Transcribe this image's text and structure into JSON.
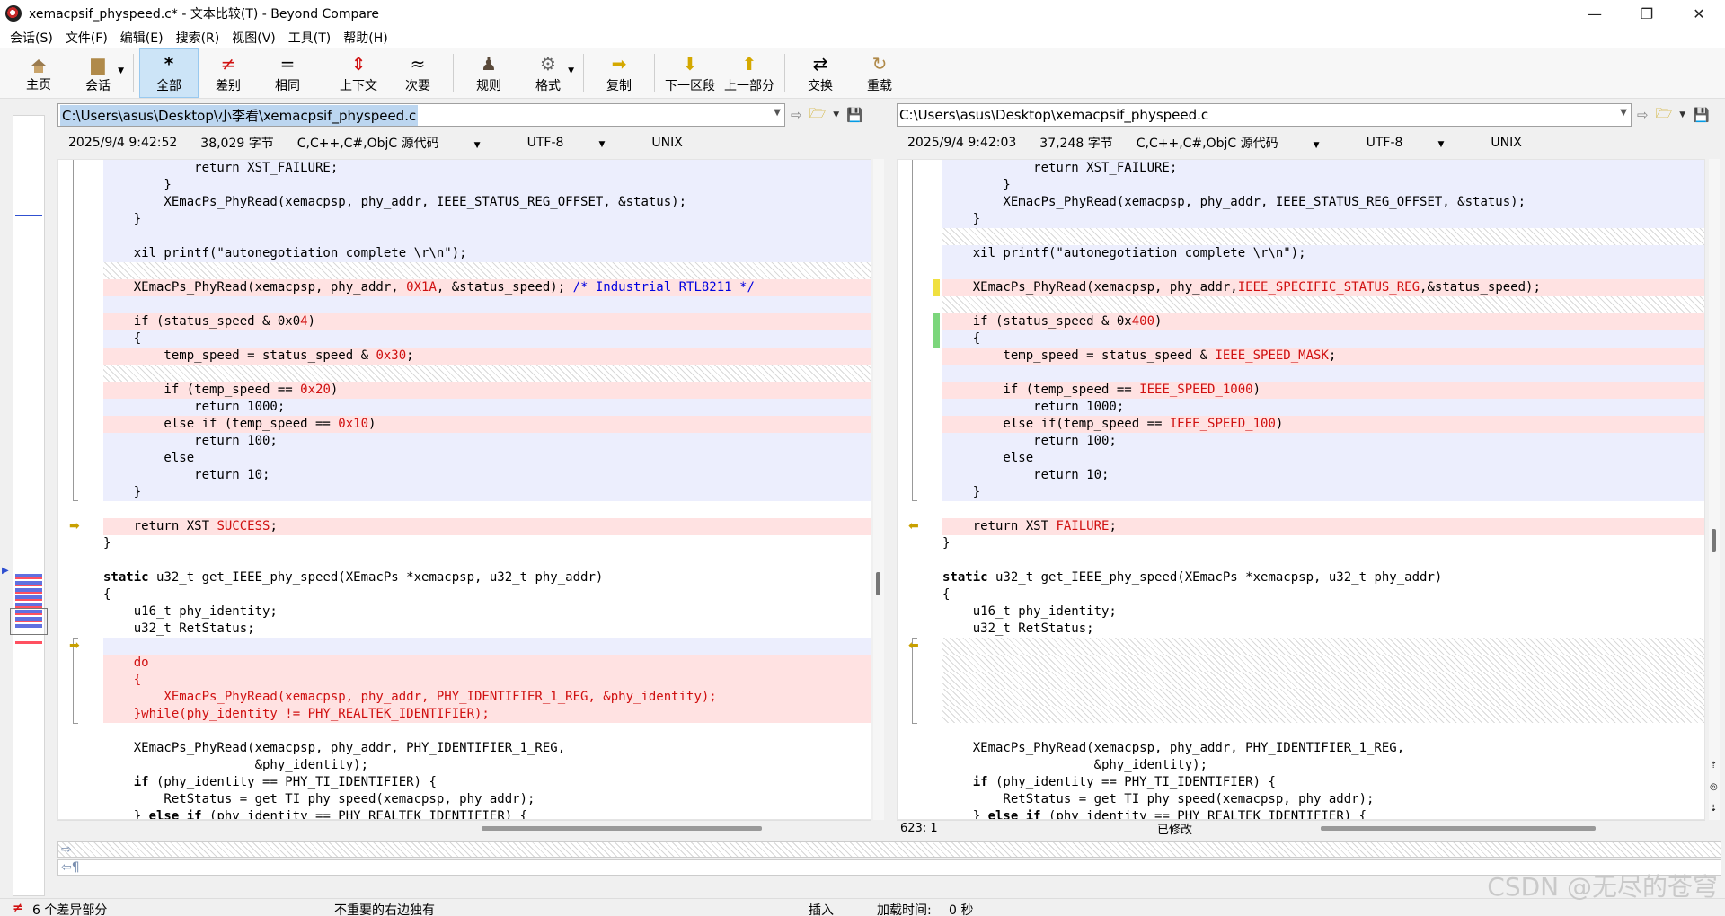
{
  "window": {
    "title": "xemacpsif_physpeed.c* - 文本比较(T) - Beyond Compare",
    "controls": {
      "minimize": "—",
      "maximize": "❐",
      "close": "✕"
    }
  },
  "menu": [
    "会话(S)",
    "文件(F)",
    "编辑(E)",
    "搜索(R)",
    "视图(V)",
    "工具(T)",
    "帮助(H)"
  ],
  "toolbar": {
    "home": "主页",
    "session": "会话",
    "all": "全部",
    "diffs": "差别",
    "same": "相同",
    "context": "上下文",
    "minor": "次要",
    "rules": "规则",
    "format": "格式",
    "copy": "复制",
    "next_section": "下一区段",
    "prev_section": "上一部分",
    "swap": "交换",
    "reload": "重载"
  },
  "left": {
    "path_prefix": "C:\\Users\\asus\\Desktop\\",
    "path_rest": "小李看\\xemacpsif_physpeed.c",
    "date": "2025/9/4 9:42:52",
    "size": "38,029 字节",
    "lang": "C,C++,C#,ObjC 源代码",
    "encoding": "UTF-8",
    "eol": "UNIX"
  },
  "right": {
    "path": "C:\\Users\\asus\\Desktop\\xemacpsif_physpeed.c",
    "date": "2025/9/4 9:42:03",
    "size": "37,248 字节",
    "lang": "C,C++,C#,ObjC 源代码",
    "encoding": "UTF-8",
    "eol": "UNIX"
  },
  "left_code": [
    {
      "cls": "ln-blue",
      "segs": [
        [
          "",
          "            return XST_FAILURE;"
        ]
      ]
    },
    {
      "cls": "ln-blue",
      "segs": [
        [
          "",
          "        }"
        ]
      ]
    },
    {
      "cls": "ln-blue",
      "segs": [
        [
          "",
          "        XEmacPs_PhyRead(xemacpsp, phy_addr, IEEE_STATUS_REG_OFFSET, &status);"
        ]
      ]
    },
    {
      "cls": "ln-blue",
      "segs": [
        [
          "",
          "    }"
        ]
      ]
    },
    {
      "cls": "ln-blue",
      "segs": [
        [
          "",
          ""
        ]
      ]
    },
    {
      "cls": "ln-blue",
      "segs": [
        [
          "",
          "    xil_printf(\"autonegotiation complete \\r\\n\");"
        ]
      ]
    },
    {
      "cls": "ln-hatch",
      "segs": [
        [
          "",
          ""
        ]
      ]
    },
    {
      "cls": "ln-red",
      "segs": [
        [
          "",
          "    XEmacPs_PhyRead(xemacpsp, phy_addr, "
        ],
        [
          "d",
          "0X1A"
        ],
        [
          "",
          ", &status_speed); "
        ],
        [
          "cm",
          "/* Industrial RTL8211 */"
        ]
      ]
    },
    {
      "cls": "ln-blue",
      "segs": [
        [
          "",
          ""
        ]
      ]
    },
    {
      "cls": "ln-red",
      "segs": [
        [
          "",
          "    if (status_speed & 0x0"
        ],
        [
          "d",
          "4"
        ],
        [
          "",
          ")"
        ]
      ]
    },
    {
      "cls": "ln-blue",
      "segs": [
        [
          "",
          "    {"
        ]
      ]
    },
    {
      "cls": "ln-red",
      "segs": [
        [
          "",
          "        temp_speed = status_speed & "
        ],
        [
          "d",
          "0x30"
        ],
        [
          "",
          ";"
        ]
      ]
    },
    {
      "cls": "ln-hatch",
      "segs": [
        [
          "",
          ""
        ]
      ]
    },
    {
      "cls": "ln-red",
      "segs": [
        [
          "",
          "        if (temp_speed == "
        ],
        [
          "d",
          "0x20"
        ],
        [
          "",
          ")"
        ]
      ]
    },
    {
      "cls": "ln-blue",
      "segs": [
        [
          "",
          "            return 1000;"
        ]
      ]
    },
    {
      "cls": "ln-red",
      "segs": [
        [
          "",
          "        else if (temp_speed == "
        ],
        [
          "d",
          "0x10"
        ],
        [
          "",
          ")"
        ]
      ]
    },
    {
      "cls": "ln-blue",
      "segs": [
        [
          "",
          "            return 100;"
        ]
      ]
    },
    {
      "cls": "ln-blue",
      "segs": [
        [
          "",
          "        else"
        ]
      ]
    },
    {
      "cls": "ln-blue",
      "segs": [
        [
          "",
          "            return 10;"
        ]
      ]
    },
    {
      "cls": "ln-blue",
      "segs": [
        [
          "",
          "    }"
        ]
      ]
    },
    {
      "cls": "ln-eq",
      "segs": [
        [
          "",
          ""
        ]
      ]
    },
    {
      "cls": "ln-red",
      "segs": [
        [
          "",
          "    return XST_"
        ],
        [
          "d",
          "SUCCESS"
        ],
        [
          "",
          ";"
        ]
      ]
    },
    {
      "cls": "ln-eq",
      "segs": [
        [
          "",
          "}"
        ]
      ]
    },
    {
      "cls": "ln-eq",
      "segs": [
        [
          "",
          ""
        ]
      ]
    },
    {
      "cls": "ln-eq",
      "segs": [
        [
          "kw",
          "static"
        ],
        [
          "",
          " u32_t get_IEEE_phy_speed(XEmacPs *xemacpsp, u32_t phy_addr)"
        ]
      ]
    },
    {
      "cls": "ln-eq",
      "segs": [
        [
          "",
          "{"
        ]
      ]
    },
    {
      "cls": "ln-eq",
      "segs": [
        [
          "",
          "    u16_t phy_identity;"
        ]
      ]
    },
    {
      "cls": "ln-eq",
      "segs": [
        [
          "",
          "    u32_t RetStatus;"
        ]
      ]
    },
    {
      "cls": "ln-blue",
      "segs": [
        [
          "",
          ""
        ]
      ]
    },
    {
      "cls": "ln-red",
      "segs": [
        [
          "d",
          "    do"
        ]
      ]
    },
    {
      "cls": "ln-red",
      "segs": [
        [
          "d",
          "    {"
        ]
      ]
    },
    {
      "cls": "ln-red",
      "segs": [
        [
          "d",
          "        XEmacPs_PhyRead(xemacpsp, phy_addr, PHY_IDENTIFIER_1_REG, &phy_identity);"
        ]
      ]
    },
    {
      "cls": "ln-red",
      "segs": [
        [
          "d",
          "    }while(phy_identity != PHY_REALTEK_IDENTIFIER);"
        ]
      ]
    },
    {
      "cls": "ln-eq",
      "segs": [
        [
          "",
          ""
        ]
      ]
    },
    {
      "cls": "ln-eq",
      "segs": [
        [
          "",
          "    XEmacPs_PhyRead(xemacpsp, phy_addr, PHY_IDENTIFIER_1_REG,"
        ]
      ]
    },
    {
      "cls": "ln-eq",
      "segs": [
        [
          "",
          "                    &phy_identity);"
        ]
      ]
    },
    {
      "cls": "ln-eq",
      "segs": [
        [
          "",
          "    "
        ],
        [
          "kw",
          "if"
        ],
        [
          "",
          " (phy_identity == PHY_TI_IDENTIFIER) {"
        ]
      ]
    },
    {
      "cls": "ln-eq",
      "segs": [
        [
          "",
          "        RetStatus = get_TI_phy_speed(xemacpsp, phy_addr);"
        ]
      ]
    },
    {
      "cls": "ln-eq",
      "segs": [
        [
          "",
          "    } "
        ],
        [
          "kw",
          "else if"
        ],
        [
          "",
          " (phy_identity == PHY_REALTEK_IDENTIFIER) {"
        ]
      ]
    }
  ],
  "right_code": [
    {
      "cls": "ln-blue",
      "segs": [
        [
          "",
          "            return XST_FAILURE;"
        ]
      ]
    },
    {
      "cls": "ln-blue",
      "segs": [
        [
          "",
          "        }"
        ]
      ]
    },
    {
      "cls": "ln-blue",
      "segs": [
        [
          "",
          "        XEmacPs_PhyRead(xemacpsp, phy_addr, IEEE_STATUS_REG_OFFSET, &status);"
        ]
      ]
    },
    {
      "cls": "ln-blue",
      "segs": [
        [
          "",
          "    }"
        ]
      ]
    },
    {
      "cls": "ln-hatch",
      "segs": [
        [
          "",
          ""
        ]
      ]
    },
    {
      "cls": "ln-blue",
      "segs": [
        [
          "",
          "    xil_printf(\"autonegotiation complete \\r\\n\");"
        ]
      ]
    },
    {
      "cls": "ln-blue",
      "segs": [
        [
          "",
          ""
        ]
      ]
    },
    {
      "cls": "ln-red",
      "segs": [
        [
          "",
          "    XEmacPs_PhyRead(xemacpsp, phy_addr,"
        ],
        [
          "d",
          "IEEE_SPECIFIC_STATUS_REG"
        ],
        [
          "",
          ",&status_speed);"
        ]
      ]
    },
    {
      "cls": "ln-hatch",
      "segs": [
        [
          "",
          ""
        ]
      ]
    },
    {
      "cls": "ln-red",
      "segs": [
        [
          "",
          "    if (status_speed & 0x"
        ],
        [
          "d",
          "400"
        ],
        [
          "",
          ")"
        ]
      ]
    },
    {
      "cls": "ln-blue",
      "segs": [
        [
          "",
          "    {"
        ]
      ]
    },
    {
      "cls": "ln-red",
      "segs": [
        [
          "",
          "        temp_speed = status_speed & "
        ],
        [
          "d",
          "IEEE_SPEED_MASK"
        ],
        [
          "",
          ";"
        ]
      ]
    },
    {
      "cls": "ln-blue",
      "segs": [
        [
          "",
          ""
        ]
      ]
    },
    {
      "cls": "ln-red",
      "segs": [
        [
          "",
          "        if (temp_speed == "
        ],
        [
          "d",
          "IEEE_SPEED_1000"
        ],
        [
          "",
          ")"
        ]
      ]
    },
    {
      "cls": "ln-blue",
      "segs": [
        [
          "",
          "            return 1000;"
        ]
      ]
    },
    {
      "cls": "ln-red",
      "segs": [
        [
          "",
          "        else if(temp_speed == "
        ],
        [
          "d",
          "IEEE_SPEED_100"
        ],
        [
          "",
          ")"
        ]
      ]
    },
    {
      "cls": "ln-blue",
      "segs": [
        [
          "",
          "            return 100;"
        ]
      ]
    },
    {
      "cls": "ln-blue",
      "segs": [
        [
          "",
          "        else"
        ]
      ]
    },
    {
      "cls": "ln-blue",
      "segs": [
        [
          "",
          "            return 10;"
        ]
      ]
    },
    {
      "cls": "ln-blue",
      "segs": [
        [
          "",
          "    }"
        ]
      ]
    },
    {
      "cls": "ln-eq",
      "segs": [
        [
          "",
          ""
        ]
      ]
    },
    {
      "cls": "ln-red",
      "segs": [
        [
          "",
          "    return XST_"
        ],
        [
          "d",
          "FAILURE"
        ],
        [
          "",
          ";"
        ]
      ]
    },
    {
      "cls": "ln-eq",
      "segs": [
        [
          "",
          "}"
        ]
      ]
    },
    {
      "cls": "ln-eq",
      "segs": [
        [
          "",
          ""
        ]
      ]
    },
    {
      "cls": "ln-eq",
      "segs": [
        [
          "kw",
          "static"
        ],
        [
          "",
          " u32_t get_IEEE_phy_speed(XEmacPs *xemacpsp, u32_t phy_addr)"
        ]
      ]
    },
    {
      "cls": "ln-eq",
      "segs": [
        [
          "",
          "{"
        ]
      ]
    },
    {
      "cls": "ln-eq",
      "segs": [
        [
          "",
          "    u16_t phy_identity;"
        ]
      ]
    },
    {
      "cls": "ln-eq",
      "segs": [
        [
          "",
          "    u32_t RetStatus;"
        ]
      ]
    },
    {
      "cls": "ln-hatch",
      "segs": [
        [
          "",
          ""
        ]
      ]
    },
    {
      "cls": "ln-hatch",
      "segs": [
        [
          "",
          ""
        ]
      ]
    },
    {
      "cls": "ln-hatch",
      "segs": [
        [
          "",
          ""
        ]
      ]
    },
    {
      "cls": "ln-hatch",
      "segs": [
        [
          "",
          ""
        ]
      ]
    },
    {
      "cls": "ln-hatch",
      "segs": [
        [
          "",
          ""
        ]
      ]
    },
    {
      "cls": "ln-eq",
      "segs": [
        [
          "",
          ""
        ]
      ]
    },
    {
      "cls": "ln-eq",
      "segs": [
        [
          "",
          "    XEmacPs_PhyRead(xemacpsp, phy_addr, PHY_IDENTIFIER_1_REG,"
        ]
      ]
    },
    {
      "cls": "ln-eq",
      "segs": [
        [
          "",
          "                    &phy_identity);"
        ]
      ]
    },
    {
      "cls": "ln-eq",
      "segs": [
        [
          "",
          "    "
        ],
        [
          "kw",
          "if"
        ],
        [
          "",
          " (phy_identity == PHY_TI_IDENTIFIER) {"
        ]
      ]
    },
    {
      "cls": "ln-eq",
      "segs": [
        [
          "",
          "        RetStatus = get_TI_phy_speed(xemacpsp, phy_addr);"
        ]
      ]
    },
    {
      "cls": "ln-eq",
      "segs": [
        [
          "",
          "    } "
        ],
        [
          "kw",
          "else if"
        ],
        [
          "",
          " (phy_identity == PHY_REALTEK_IDENTIFIER) {"
        ]
      ]
    }
  ],
  "cursor_pos": "623: 1",
  "modified": "已修改",
  "status": {
    "diff_count": "6 个差异部分",
    "unimportant": "不重要的右边独有",
    "insert": "插入",
    "load_time_label": "加载时间:",
    "load_time": "0 秒"
  },
  "watermark": "CSDN @无尽的苍穹",
  "colors": {
    "diff_red": "#d01010",
    "blue_bg": "#eceefd",
    "red_bg": "#ffe2e2",
    "accent": "#cce4f7"
  }
}
